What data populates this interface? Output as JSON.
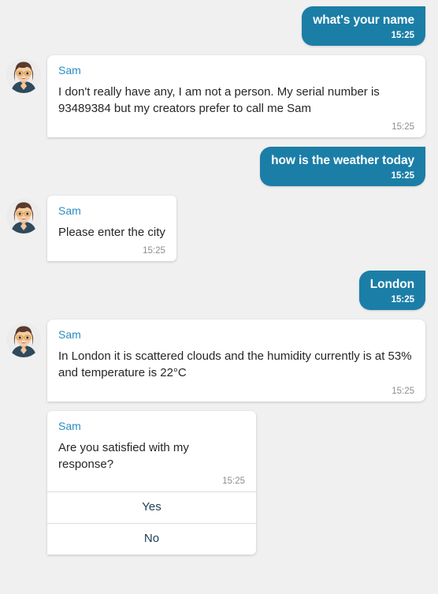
{
  "theme": {
    "page_background": "#f0f0f0",
    "user_bubble_color": "#1b7ea7",
    "user_bubble_text": "#ffffff",
    "bot_bubble_color": "#ffffff",
    "bot_bubble_text": "#262626",
    "sender_name_color": "#2b8cc4",
    "timestamp_color": "#8d8d8d",
    "action_button_text_color": "#1f3c57"
  },
  "bot": {
    "name": "Sam",
    "avatar_icon": "woman-with-glasses-avatar-icon"
  },
  "conversation": [
    {
      "id": "msg-1",
      "from": "user",
      "text": "what's your name",
      "time": "15:25"
    },
    {
      "id": "msg-2",
      "from": "bot",
      "sender": "Sam",
      "text": "I don't really have any, I am not a person. My serial number is 93489384 but my creators prefer to call me Sam",
      "time": "15:25"
    },
    {
      "id": "msg-3",
      "from": "user",
      "text": "how is the weather today",
      "time": "15:25"
    },
    {
      "id": "msg-4",
      "from": "bot",
      "sender": "Sam",
      "text": "Please enter the city",
      "time": "15:25"
    },
    {
      "id": "msg-5",
      "from": "user",
      "text": "London",
      "time": "15:25"
    },
    {
      "id": "msg-6",
      "from": "bot",
      "sender": "Sam",
      "text": "In London it is scattered clouds and the humidity currently is at 53% and temperature is 22°C",
      "time": "15:25"
    },
    {
      "id": "msg-7",
      "from": "bot-card",
      "sender": "Sam",
      "text": "Are you satisfied with my response?",
      "time": "15:25",
      "actions": [
        {
          "id": "action-yes",
          "label": "Yes"
        },
        {
          "id": "action-no",
          "label": "No"
        }
      ]
    }
  ]
}
